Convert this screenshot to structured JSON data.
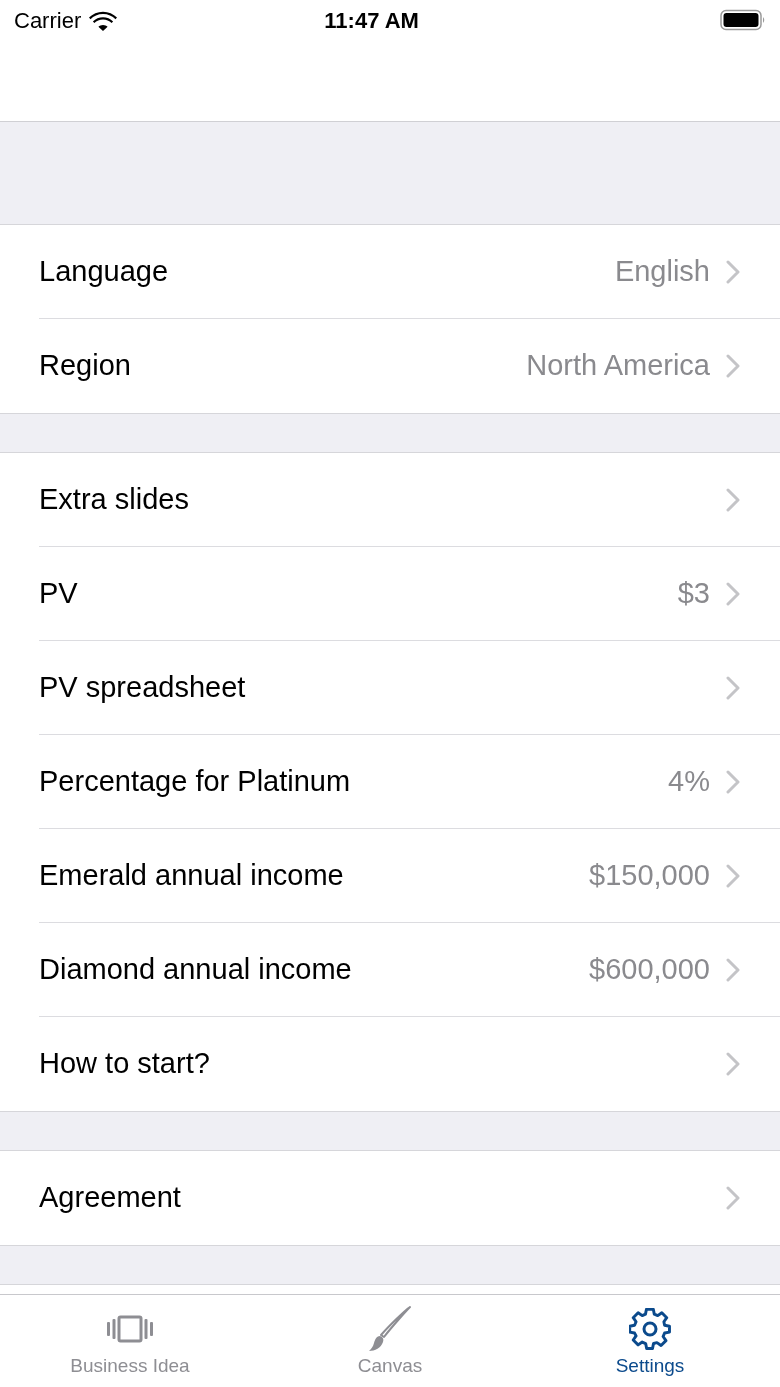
{
  "status_bar": {
    "carrier": "Carrier",
    "time": "11:47 AM"
  },
  "sections": [
    {
      "rows": [
        {
          "label": "Language",
          "value": "English"
        },
        {
          "label": "Region",
          "value": "North America"
        }
      ]
    },
    {
      "rows": [
        {
          "label": "Extra slides"
        },
        {
          "label": "PV",
          "value": "$3"
        },
        {
          "label": "PV spreadsheet"
        },
        {
          "label": "Percentage for Platinum",
          "value": "4%"
        },
        {
          "label": "Emerald annual income",
          "value": "$150,000"
        },
        {
          "label": "Diamond annual income",
          "value": "$600,000"
        },
        {
          "label": "How to start?"
        }
      ]
    },
    {
      "rows": [
        {
          "label": "Agreement"
        }
      ]
    }
  ],
  "tab_bar": [
    {
      "label": "Business Idea",
      "selected": false
    },
    {
      "label": "Canvas",
      "selected": false
    },
    {
      "label": "Settings",
      "selected": true
    }
  ]
}
